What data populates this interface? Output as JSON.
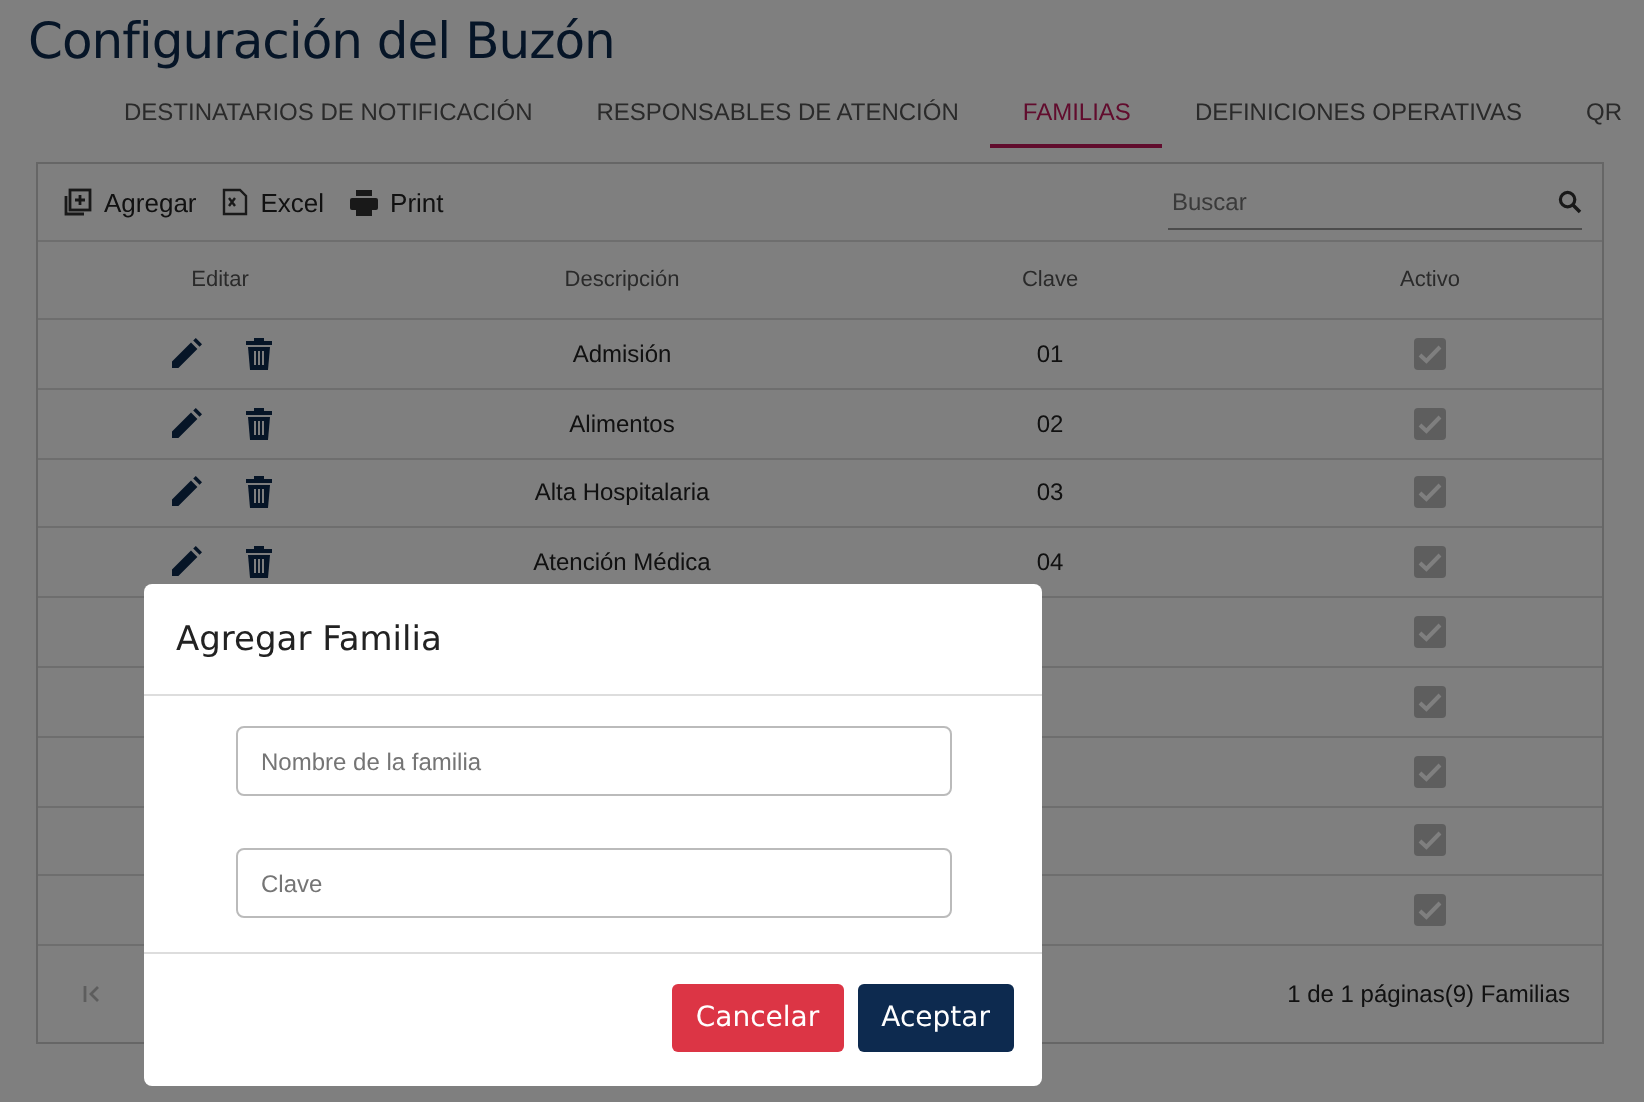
{
  "title": "Configuración del Buzón",
  "tabs": [
    {
      "label": "DESTINATARIOS DE NOTIFICACIÓN",
      "selected": false
    },
    {
      "label": "RESPONSABLES DE ATENCIÓN",
      "selected": false
    },
    {
      "label": "FAMILIAS",
      "selected": true
    },
    {
      "label": "DEFINICIONES OPERATIVAS",
      "selected": false
    },
    {
      "label": "QR",
      "selected": false
    }
  ],
  "toolbar": [
    {
      "kind": "add",
      "label": "Agregar"
    },
    {
      "kind": "excel",
      "label": "Excel"
    },
    {
      "kind": "print",
      "label": "Print"
    }
  ],
  "search": {
    "placeholder": "Buscar"
  },
  "table": {
    "columns": [
      "Editar",
      "Descripción",
      "Clave",
      "Activo"
    ],
    "rows": [
      {
        "description": "Admisión",
        "key": "01",
        "active": true
      },
      {
        "description": "Alimentos",
        "key": "02",
        "active": true
      },
      {
        "description": "Alta Hospitalaria",
        "key": "03",
        "active": true
      },
      {
        "description": "Atención Médica",
        "key": "04",
        "active": true
      },
      {
        "active": true
      },
      {
        "active": true
      },
      {
        "active": true
      },
      {
        "active": true
      },
      {
        "active": true
      }
    ]
  },
  "pager": {
    "summary": "1 de 1 páginas(9) Familias"
  },
  "dialog": {
    "title": "Agregar Familia",
    "fields": [
      {
        "placeholder": "Nombre de la familia"
      },
      {
        "placeholder": "Clave"
      }
    ],
    "buttons": [
      {
        "kind": "cancel",
        "label": "Cancelar"
      },
      {
        "kind": "accept",
        "label": "Aceptar"
      }
    ]
  }
}
